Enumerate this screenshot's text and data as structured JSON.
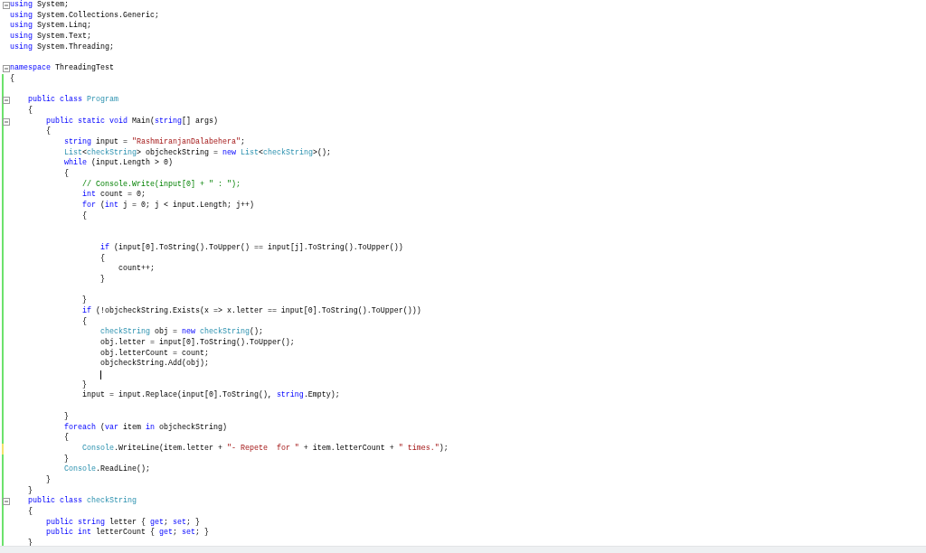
{
  "editor": {
    "lines": [
      {
        "collapsible": true,
        "modified": false,
        "tokens": [
          {
            "text": "using",
            "kind": "keyword"
          },
          {
            "text": " System;",
            "kind": "plain"
          }
        ]
      },
      {
        "collapsible": false,
        "modified": false,
        "tokens": [
          {
            "text": "using",
            "kind": "keyword"
          },
          {
            "text": " System.Collections.Generic;",
            "kind": "plain"
          }
        ]
      },
      {
        "collapsible": false,
        "modified": false,
        "tokens": [
          {
            "text": "using",
            "kind": "keyword"
          },
          {
            "text": " System.Linq;",
            "kind": "plain"
          }
        ]
      },
      {
        "collapsible": false,
        "modified": false,
        "tokens": [
          {
            "text": "using",
            "kind": "keyword"
          },
          {
            "text": " System.Text;",
            "kind": "plain"
          }
        ]
      },
      {
        "collapsible": false,
        "modified": false,
        "tokens": [
          {
            "text": "using",
            "kind": "keyword"
          },
          {
            "text": " System.Threading;",
            "kind": "plain"
          }
        ]
      },
      {
        "collapsible": false,
        "modified": false
      },
      {
        "collapsible": true,
        "modified": false,
        "tokens": [
          {
            "text": "namespace",
            "kind": "keyword"
          },
          {
            "text": " ThreadingTest",
            "kind": "plain"
          }
        ]
      },
      {
        "collapsible": false,
        "modified": true,
        "saved": true,
        "tokens": [
          {
            "text": "{",
            "kind": "plain"
          }
        ]
      },
      {
        "collapsible": false,
        "modified": true,
        "saved": true
      },
      {
        "collapsible": true,
        "modified": true,
        "saved": true,
        "tokens": [
          {
            "text": "    public class ",
            "kind": "keyword"
          },
          {
            "text": "Program",
            "kind": "type"
          }
        ]
      },
      {
        "collapsible": false,
        "modified": true,
        "saved": true,
        "tokens": [
          {
            "text": "    {",
            "kind": "plain"
          }
        ]
      },
      {
        "collapsible": true,
        "modified": true,
        "saved": true,
        "tokens": [
          {
            "text": "        public static void",
            "kind": "keyword"
          },
          {
            "text": " Main(",
            "kind": "plain"
          },
          {
            "text": "string",
            "kind": "keyword"
          },
          {
            "text": "[] args)",
            "kind": "plain"
          }
        ]
      },
      {
        "collapsible": false,
        "modified": true,
        "saved": true,
        "tokens": [
          {
            "text": "        {",
            "kind": "plain"
          }
        ]
      },
      {
        "collapsible": false,
        "modified": true,
        "saved": true,
        "tokens": [
          {
            "text": "            string",
            "kind": "keyword"
          },
          {
            "text": " input = ",
            "kind": "plain"
          },
          {
            "text": "\"RashmiranjanDalabehera\"",
            "kind": "string"
          },
          {
            "text": ";",
            "kind": "plain"
          }
        ]
      },
      {
        "collapsible": false,
        "modified": true,
        "saved": true,
        "tokens": [
          {
            "text": "            List",
            "kind": "type"
          },
          {
            "text": "<",
            "kind": "plain"
          },
          {
            "text": "checkString",
            "kind": "type"
          },
          {
            "text": "> objcheckString = ",
            "kind": "plain"
          },
          {
            "text": "new ",
            "kind": "keyword"
          },
          {
            "text": "List",
            "kind": "type"
          },
          {
            "text": "<",
            "kind": "plain"
          },
          {
            "text": "checkString",
            "kind": "type"
          },
          {
            "text": ">();",
            "kind": "plain"
          }
        ]
      },
      {
        "collapsible": false,
        "modified": true,
        "saved": true,
        "tokens": [
          {
            "text": "            while",
            "kind": "keyword"
          },
          {
            "text": " (input.Length > 0)",
            "kind": "plain"
          }
        ]
      },
      {
        "collapsible": false,
        "modified": true,
        "saved": true,
        "tokens": [
          {
            "text": "            {",
            "kind": "plain"
          }
        ]
      },
      {
        "collapsible": false,
        "modified": true,
        "saved": true,
        "tokens": [
          {
            "text": "                // Console.Write(input[0] + \" : \");",
            "kind": "comment"
          }
        ]
      },
      {
        "collapsible": false,
        "modified": true,
        "saved": true,
        "tokens": [
          {
            "text": "                int",
            "kind": "keyword"
          },
          {
            "text": " count = 0;",
            "kind": "plain"
          }
        ]
      },
      {
        "collapsible": false,
        "modified": true,
        "saved": true,
        "tokens": [
          {
            "text": "                for",
            "kind": "keyword"
          },
          {
            "text": " (",
            "kind": "plain"
          },
          {
            "text": "int",
            "kind": "keyword"
          },
          {
            "text": " j = 0; j < input.Length; j++)",
            "kind": "plain"
          }
        ]
      },
      {
        "collapsible": false,
        "modified": true,
        "saved": true,
        "tokens": [
          {
            "text": "                {",
            "kind": "plain"
          }
        ]
      },
      {
        "collapsible": false,
        "modified": true,
        "saved": true
      },
      {
        "collapsible": false,
        "modified": true,
        "saved": true
      },
      {
        "collapsible": false,
        "modified": true,
        "saved": true,
        "tokens": [
          {
            "text": "                    if",
            "kind": "keyword"
          },
          {
            "text": " (input[0].ToString().ToUpper() == input[j].ToString().ToUpper())",
            "kind": "plain"
          }
        ]
      },
      {
        "collapsible": false,
        "modified": true,
        "saved": true,
        "tokens": [
          {
            "text": "                    {",
            "kind": "plain"
          }
        ]
      },
      {
        "collapsible": false,
        "modified": true,
        "saved": true,
        "tokens": [
          {
            "text": "                        count++;",
            "kind": "plain"
          }
        ]
      },
      {
        "collapsible": false,
        "modified": true,
        "saved": true,
        "tokens": [
          {
            "text": "                    }",
            "kind": "plain"
          }
        ]
      },
      {
        "collapsible": false,
        "modified": true,
        "saved": true
      },
      {
        "collapsible": false,
        "modified": true,
        "saved": true,
        "tokens": [
          {
            "text": "                }",
            "kind": "plain"
          }
        ]
      },
      {
        "collapsible": false,
        "modified": true,
        "saved": true,
        "tokens": [
          {
            "text": "                if",
            "kind": "keyword"
          },
          {
            "text": " (!objcheckString.Exists(x => x.letter == input[0].ToString().ToUpper()))",
            "kind": "plain"
          }
        ]
      },
      {
        "collapsible": false,
        "modified": true,
        "saved": true,
        "tokens": [
          {
            "text": "                {",
            "kind": "plain"
          }
        ]
      },
      {
        "collapsible": false,
        "modified": true,
        "saved": true,
        "tokens": [
          {
            "text": "                    checkString",
            "kind": "type"
          },
          {
            "text": " obj = ",
            "kind": "plain"
          },
          {
            "text": "new ",
            "kind": "keyword"
          },
          {
            "text": "checkString",
            "kind": "type"
          },
          {
            "text": "();",
            "kind": "plain"
          }
        ]
      },
      {
        "collapsible": false,
        "modified": true,
        "saved": true,
        "tokens": [
          {
            "text": "                    obj.letter = input[0].ToString().ToUpper();",
            "kind": "plain"
          }
        ]
      },
      {
        "collapsible": false,
        "modified": true,
        "saved": true,
        "tokens": [
          {
            "text": "                    obj.letterCount = count;",
            "kind": "plain"
          }
        ]
      },
      {
        "collapsible": false,
        "modified": true,
        "saved": true,
        "tokens": [
          {
            "text": "                    objcheckString.Add(obj);",
            "kind": "plain"
          }
        ]
      },
      {
        "collapsible": false,
        "modified": true,
        "saved": true,
        "caret": true
      },
      {
        "collapsible": false,
        "modified": true,
        "saved": true,
        "tokens": [
          {
            "text": "                }",
            "kind": "plain"
          }
        ]
      },
      {
        "collapsible": false,
        "modified": true,
        "saved": true,
        "tokens": [
          {
            "text": "                input = input.Replace(input[0].ToString(), ",
            "kind": "plain"
          },
          {
            "text": "string",
            "kind": "keyword"
          },
          {
            "text": ".Empty);",
            "kind": "plain"
          }
        ]
      },
      {
        "collapsible": false,
        "modified": true,
        "saved": true
      },
      {
        "collapsible": false,
        "modified": true,
        "saved": true,
        "tokens": [
          {
            "text": "            }",
            "kind": "plain"
          }
        ]
      },
      {
        "collapsible": false,
        "modified": true,
        "saved": true,
        "tokens": [
          {
            "text": "            foreach",
            "kind": "keyword"
          },
          {
            "text": " (",
            "kind": "plain"
          },
          {
            "text": "var",
            "kind": "keyword"
          },
          {
            "text": " item ",
            "kind": "plain"
          },
          {
            "text": "in",
            "kind": "keyword"
          },
          {
            "text": " objcheckString)",
            "kind": "plain"
          }
        ]
      },
      {
        "collapsible": false,
        "modified": true,
        "saved": true,
        "tokens": [
          {
            "text": "            {",
            "kind": "plain"
          }
        ]
      },
      {
        "collapsible": false,
        "modified": true,
        "saved": false,
        "tokens": [
          {
            "text": "                Console",
            "kind": "type"
          },
          {
            "text": ".WriteLine(item.letter + ",
            "kind": "plain"
          },
          {
            "text": "\"- Repete  for \"",
            "kind": "string"
          },
          {
            "text": " + item.letterCount + ",
            "kind": "plain"
          },
          {
            "text": "\" times.\"",
            "kind": "string"
          },
          {
            "text": ");",
            "kind": "plain"
          }
        ]
      },
      {
        "collapsible": false,
        "modified": true,
        "saved": true,
        "tokens": [
          {
            "text": "            }",
            "kind": "plain"
          }
        ]
      },
      {
        "collapsible": false,
        "modified": true,
        "saved": true,
        "tokens": [
          {
            "text": "            Console",
            "kind": "type"
          },
          {
            "text": ".ReadLine();",
            "kind": "plain"
          }
        ]
      },
      {
        "collapsible": false,
        "modified": true,
        "saved": true,
        "tokens": [
          {
            "text": "        }",
            "kind": "plain"
          }
        ]
      },
      {
        "collapsible": false,
        "modified": true,
        "saved": true,
        "tokens": [
          {
            "text": "    }",
            "kind": "plain"
          }
        ]
      },
      {
        "collapsible": true,
        "modified": true,
        "saved": true,
        "tokens": [
          {
            "text": "    public class ",
            "kind": "keyword"
          },
          {
            "text": "checkString",
            "kind": "type"
          }
        ]
      },
      {
        "collapsible": false,
        "modified": true,
        "saved": true,
        "tokens": [
          {
            "text": "    {",
            "kind": "plain"
          }
        ]
      },
      {
        "collapsible": false,
        "modified": true,
        "saved": true,
        "tokens": [
          {
            "text": "        public string",
            "kind": "keyword"
          },
          {
            "text": " letter { ",
            "kind": "plain"
          },
          {
            "text": "get",
            "kind": "keyword"
          },
          {
            "text": "; ",
            "kind": "plain"
          },
          {
            "text": "set",
            "kind": "keyword"
          },
          {
            "text": "; }",
            "kind": "plain"
          }
        ]
      },
      {
        "collapsible": false,
        "modified": true,
        "saved": true,
        "tokens": [
          {
            "text": "        public int",
            "kind": "keyword"
          },
          {
            "text": " letterCount { ",
            "kind": "plain"
          },
          {
            "text": "get",
            "kind": "keyword"
          },
          {
            "text": "; ",
            "kind": "plain"
          },
          {
            "text": "set",
            "kind": "keyword"
          },
          {
            "text": "; }",
            "kind": "plain"
          }
        ]
      },
      {
        "collapsible": false,
        "modified": true,
        "saved": true,
        "tokens": [
          {
            "text": "    }",
            "kind": "plain"
          }
        ]
      }
    ]
  }
}
